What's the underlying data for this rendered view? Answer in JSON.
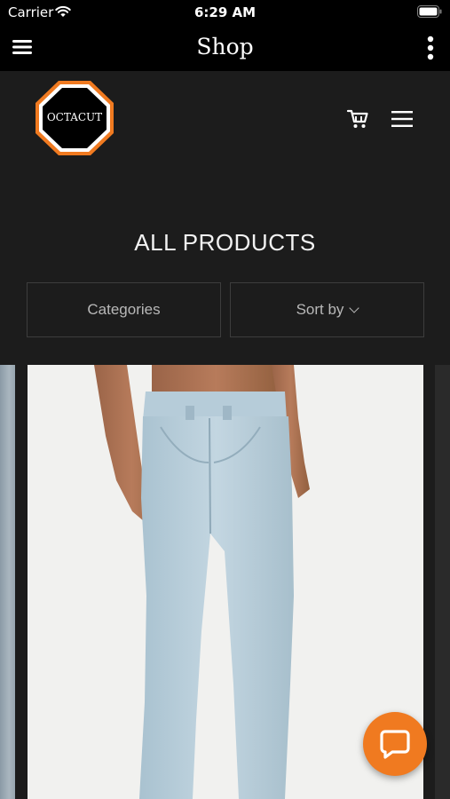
{
  "status_bar": {
    "carrier": "Carrier",
    "time": "6:29 AM"
  },
  "nav_bar": {
    "title": "Shop"
  },
  "header": {
    "logo_text": "OCTACUT"
  },
  "page": {
    "heading": "ALL PRODUCTS"
  },
  "filters": {
    "categories_label": "Categories",
    "sort_label": "Sort by"
  },
  "colors": {
    "background": "#1c1c1c",
    "bar": "#000000",
    "accent": "#f07a20",
    "filter_border": "#3d3d3d"
  },
  "icons": {
    "nav_menu": "hamburger-icon",
    "nav_more": "vertical-ellipsis-icon",
    "cart": "cart-icon",
    "site_menu": "hamburger-icon",
    "chat": "chat-bubble-icon"
  }
}
